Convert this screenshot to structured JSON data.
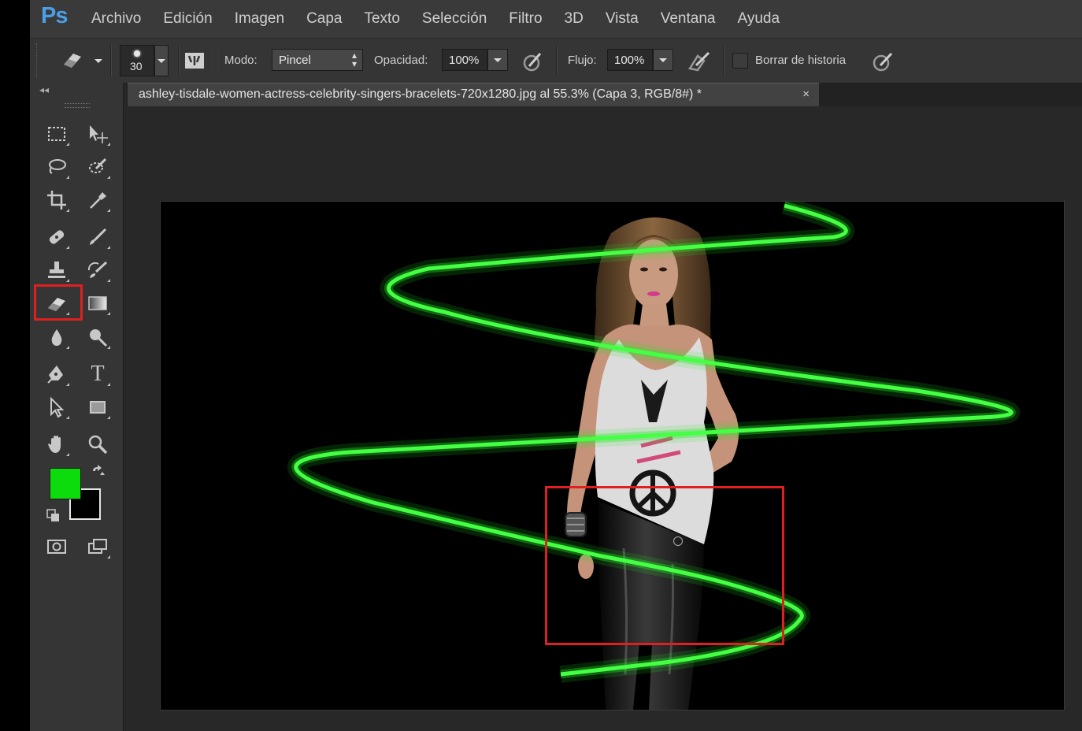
{
  "app": {
    "logo": "Ps"
  },
  "menu": [
    "Archivo",
    "Edición",
    "Imagen",
    "Capa",
    "Texto",
    "Selección",
    "Filtro",
    "3D",
    "Vista",
    "Ventana",
    "Ayuda"
  ],
  "options": {
    "brush_size": "30",
    "mode_label": "Modo:",
    "mode_value": "Pincel",
    "opacity_label": "Opacidad:",
    "opacity_value": "100%",
    "flow_label": "Flujo:",
    "flow_value": "100%",
    "erase_history_label": "Borrar de historia",
    "erase_history_checked": false
  },
  "document": {
    "tab_title": "ashley-tisdale-women-actress-celebrity-singers-bracelets-720x1280.jpg al 55.3% (Capa 3, RGB/8#) *",
    "close_glyph": "×"
  },
  "tools": {
    "active_tool": "eraser-tool",
    "type_tool_glyph": "T",
    "collapse_glyph": "◂◂"
  },
  "colors": {
    "foreground": "#0cdc0c",
    "background": "#000000",
    "glow_line": "#22ee22",
    "highlight": "#e02020",
    "ps_blue": "#4a9fe8"
  }
}
